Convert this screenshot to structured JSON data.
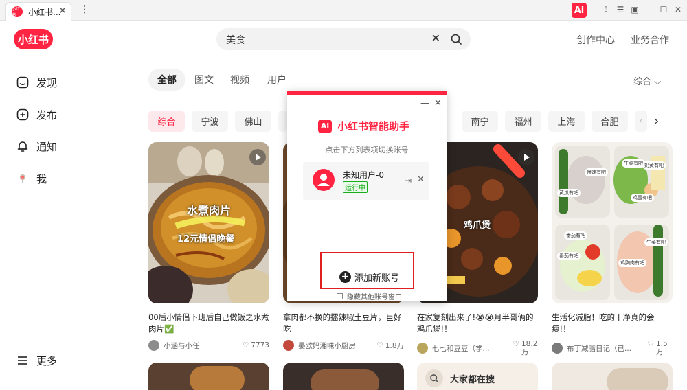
{
  "browser": {
    "tab_title": "小红书...",
    "tab_logo_text": "小红书",
    "close_glyph": "✕",
    "more_glyph": "⋮",
    "ai_badge": "Ai",
    "window_controls": [
      "⇪",
      "☰",
      "▣",
      "—",
      "☐",
      "✕"
    ]
  },
  "header": {
    "logo": "小红书",
    "search_value": "美食",
    "clear_glyph": "✕",
    "links": [
      "创作中心",
      "业务合作"
    ]
  },
  "sidebar": {
    "items": [
      {
        "label": "发现",
        "icon": "home-icon"
      },
      {
        "label": "发布",
        "icon": "plus-square-icon"
      },
      {
        "label": "通知",
        "icon": "bell-icon"
      },
      {
        "label": "我",
        "icon": "user-icon"
      }
    ],
    "more": "更多"
  },
  "content_tabs": {
    "tabs": [
      "全部",
      "图文",
      "视频",
      "用户"
    ],
    "sort_label": "综合 ⌵"
  },
  "chips": [
    "综合",
    "宁波",
    "佛山",
    "南宁",
    "福州",
    "上海",
    "合肥",
    "‹"
  ],
  "chip_next": "›",
  "cards": [
    {
      "title": "00后小情侣下班后自己做饭之水煮肉片✅",
      "author": "小涵与小任",
      "likes": "7773",
      "overlay_1": "水煮肉片",
      "overlay_2": "12元情侣晚餐"
    },
    {
      "title": "拿肉都不换的擂辣椒土豆片，巨好吃",
      "author": "晏欧妈湘味小厨房",
      "likes": "1.8万"
    },
    {
      "title": "在家复刻出来了!😭😭月半哥俩的鸡爪煲!！",
      "author": "七七和豆豆（学...",
      "likes": "18.2万",
      "overlay_1": "鸡爪煲"
    },
    {
      "title": "生活化减脂！吃的干净真的会瘦!！",
      "author": "布丁减脂日记（已...",
      "likes": "1.5万",
      "labels": [
        "慢速有吧",
        "生菜有吧",
        "奶黄有吧",
        "黄瓜有吧",
        "鸡蛋有吧",
        "番茄有吧",
        "生菜有吧",
        "番茄有吧",
        "鸡胸肉有吧"
      ]
    }
  ],
  "bottom_row": {
    "search_card": "大家都在搜"
  },
  "dialog": {
    "minimize": "—",
    "close": "✕",
    "ai_label": "Ai",
    "title": "小红书智能助手",
    "subtitle": "点击下方列表项切换账号",
    "account_name": "未知用户-0",
    "account_status": "运行中",
    "logout_glyph": "⇥",
    "remove_glyph": "✕",
    "add_label": "添加新账号",
    "hide_label": "隐藏其他账号窗口"
  },
  "colors": {
    "brand": "#ff2442",
    "running": "#1aad19",
    "highlight_box": "#e02020"
  }
}
